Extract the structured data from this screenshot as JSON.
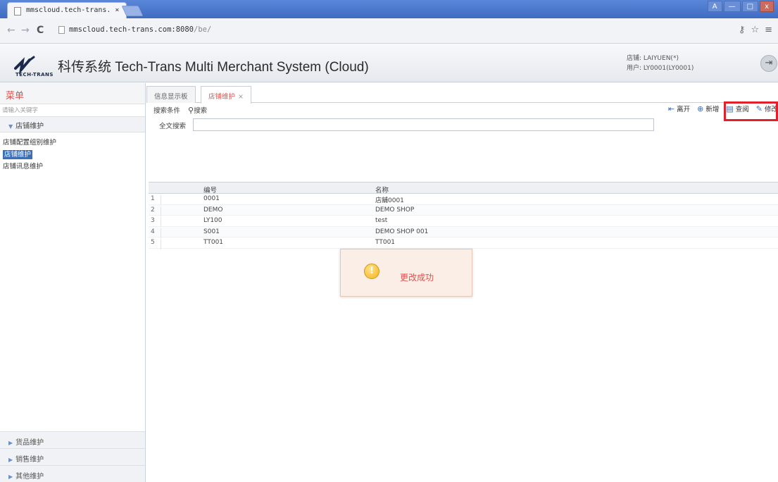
{
  "browser": {
    "tab_title": "mmscloud.tech-trans. ×",
    "url_host": "mmscloud.tech-trans.com:8080",
    "url_path": "/be/",
    "window_buttons": [
      "A",
      "—",
      "□",
      "x"
    ]
  },
  "header": {
    "logo_text": "TECH-TRANS",
    "title": "科传系统 Tech-Trans Multi Merchant System (Cloud)",
    "store_label": "店铺: LAIYUEN(*)",
    "user_label": "用户: LY0001(LY0001)"
  },
  "sidebar": {
    "menu_title": "菜单",
    "search_placeholder": "请输入关键字",
    "open_group": "店铺维护",
    "items": [
      "店铺配置组别维护",
      "店铺维护",
      "店铺讯息维护"
    ],
    "bottom_groups": [
      "货品维护",
      "销售维护",
      "其他维护"
    ]
  },
  "main": {
    "tabs": [
      {
        "label": "信息显示板"
      },
      {
        "label": "店铺维护"
      }
    ],
    "search_conditions_label": "搜索条件",
    "search_label": "搜索",
    "fulltext_label": "全文搜索",
    "actions": {
      "leave": "离开",
      "add": "新增",
      "view": "查阅",
      "edit": "修改"
    },
    "table": {
      "columns": [
        "编号",
        "名称"
      ],
      "rows": [
        {
          "idx": "1",
          "code": "0001",
          "name": "店舖0001"
        },
        {
          "idx": "2",
          "code": "DEMO",
          "name": "DEMO SHOP"
        },
        {
          "idx": "3",
          "code": "LY100",
          "name": "test"
        },
        {
          "idx": "4",
          "code": "S001",
          "name": "DEMO SHOP 001"
        },
        {
          "idx": "5",
          "code": "TT001",
          "name": "TT001"
        }
      ]
    }
  },
  "toast": {
    "icon": "warning-icon",
    "message": "更改成功"
  },
  "colors": {
    "accent_red": "#d9534f",
    "highlight": "#e0202a",
    "selection": "#3b6fb8"
  }
}
